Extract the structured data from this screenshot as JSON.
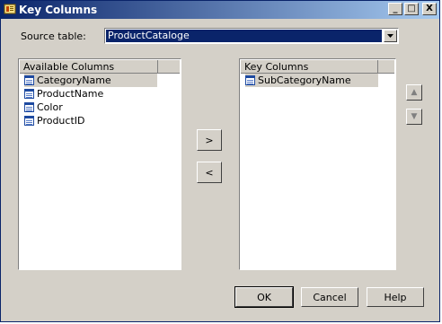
{
  "window": {
    "title": "Key Columns",
    "controls": {
      "minimize": "_",
      "maximize": "□",
      "close": "X"
    }
  },
  "source": {
    "label": "Source table:",
    "selected": "ProductCataloge"
  },
  "available": {
    "header": "Available Columns",
    "items": [
      "CategoryName",
      "ProductName",
      "Color",
      "ProductID"
    ],
    "selected_index": 0
  },
  "key": {
    "header": "Key Columns",
    "items": [
      "SubCategoryName"
    ],
    "selected_index": 0
  },
  "transfer": {
    "add": ">",
    "remove": "<"
  },
  "order": {
    "up": "▲",
    "down": "▼"
  },
  "buttons": {
    "ok": "OK",
    "cancel": "Cancel",
    "help": "Help"
  },
  "icons": {
    "title": "key-icon",
    "column": "column-icon"
  }
}
